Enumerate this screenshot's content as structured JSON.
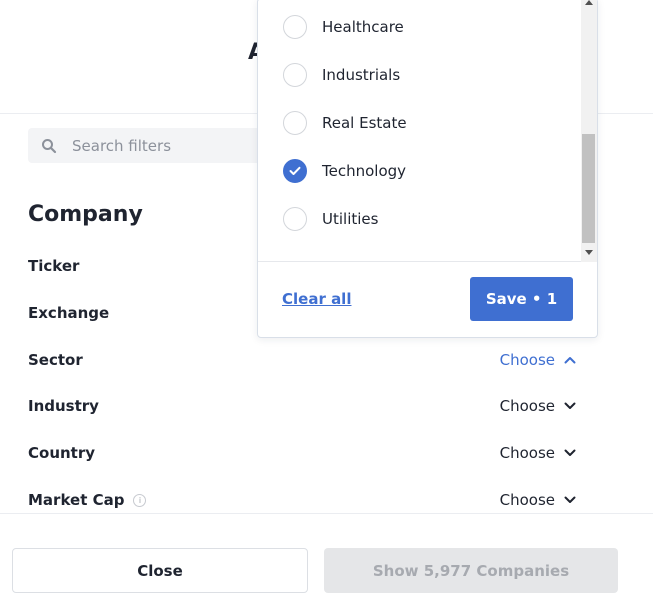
{
  "header": {
    "title_partial": "A"
  },
  "search": {
    "placeholder": "Search filters",
    "value": ""
  },
  "section": {
    "title": "Company"
  },
  "filters": [
    {
      "label": "Ticker"
    },
    {
      "label": "Exchange"
    },
    {
      "label": "Sector",
      "action": "Choose",
      "expanded": true
    },
    {
      "label": "Industry",
      "action": "Choose"
    },
    {
      "label": "Country",
      "action": "Choose"
    },
    {
      "label": "Market Cap",
      "action": "Choose",
      "info_icon": "i"
    }
  ],
  "dropdown": {
    "options": [
      {
        "label": "Healthcare",
        "checked": false
      },
      {
        "label": "Industrials",
        "checked": false
      },
      {
        "label": "Real Estate",
        "checked": false
      },
      {
        "label": "Technology",
        "checked": true
      },
      {
        "label": "Utilities",
        "checked": false
      }
    ],
    "clear_label": "Clear all",
    "save_label": "Save • 1"
  },
  "footer": {
    "close_label": "Close",
    "show_label": "Show 5,977 Companies"
  },
  "colors": {
    "accent": "#3f6fd1",
    "text": "#1f2430",
    "disabled_bg": "#e5e6e8",
    "disabled_text": "#a7aab0"
  }
}
